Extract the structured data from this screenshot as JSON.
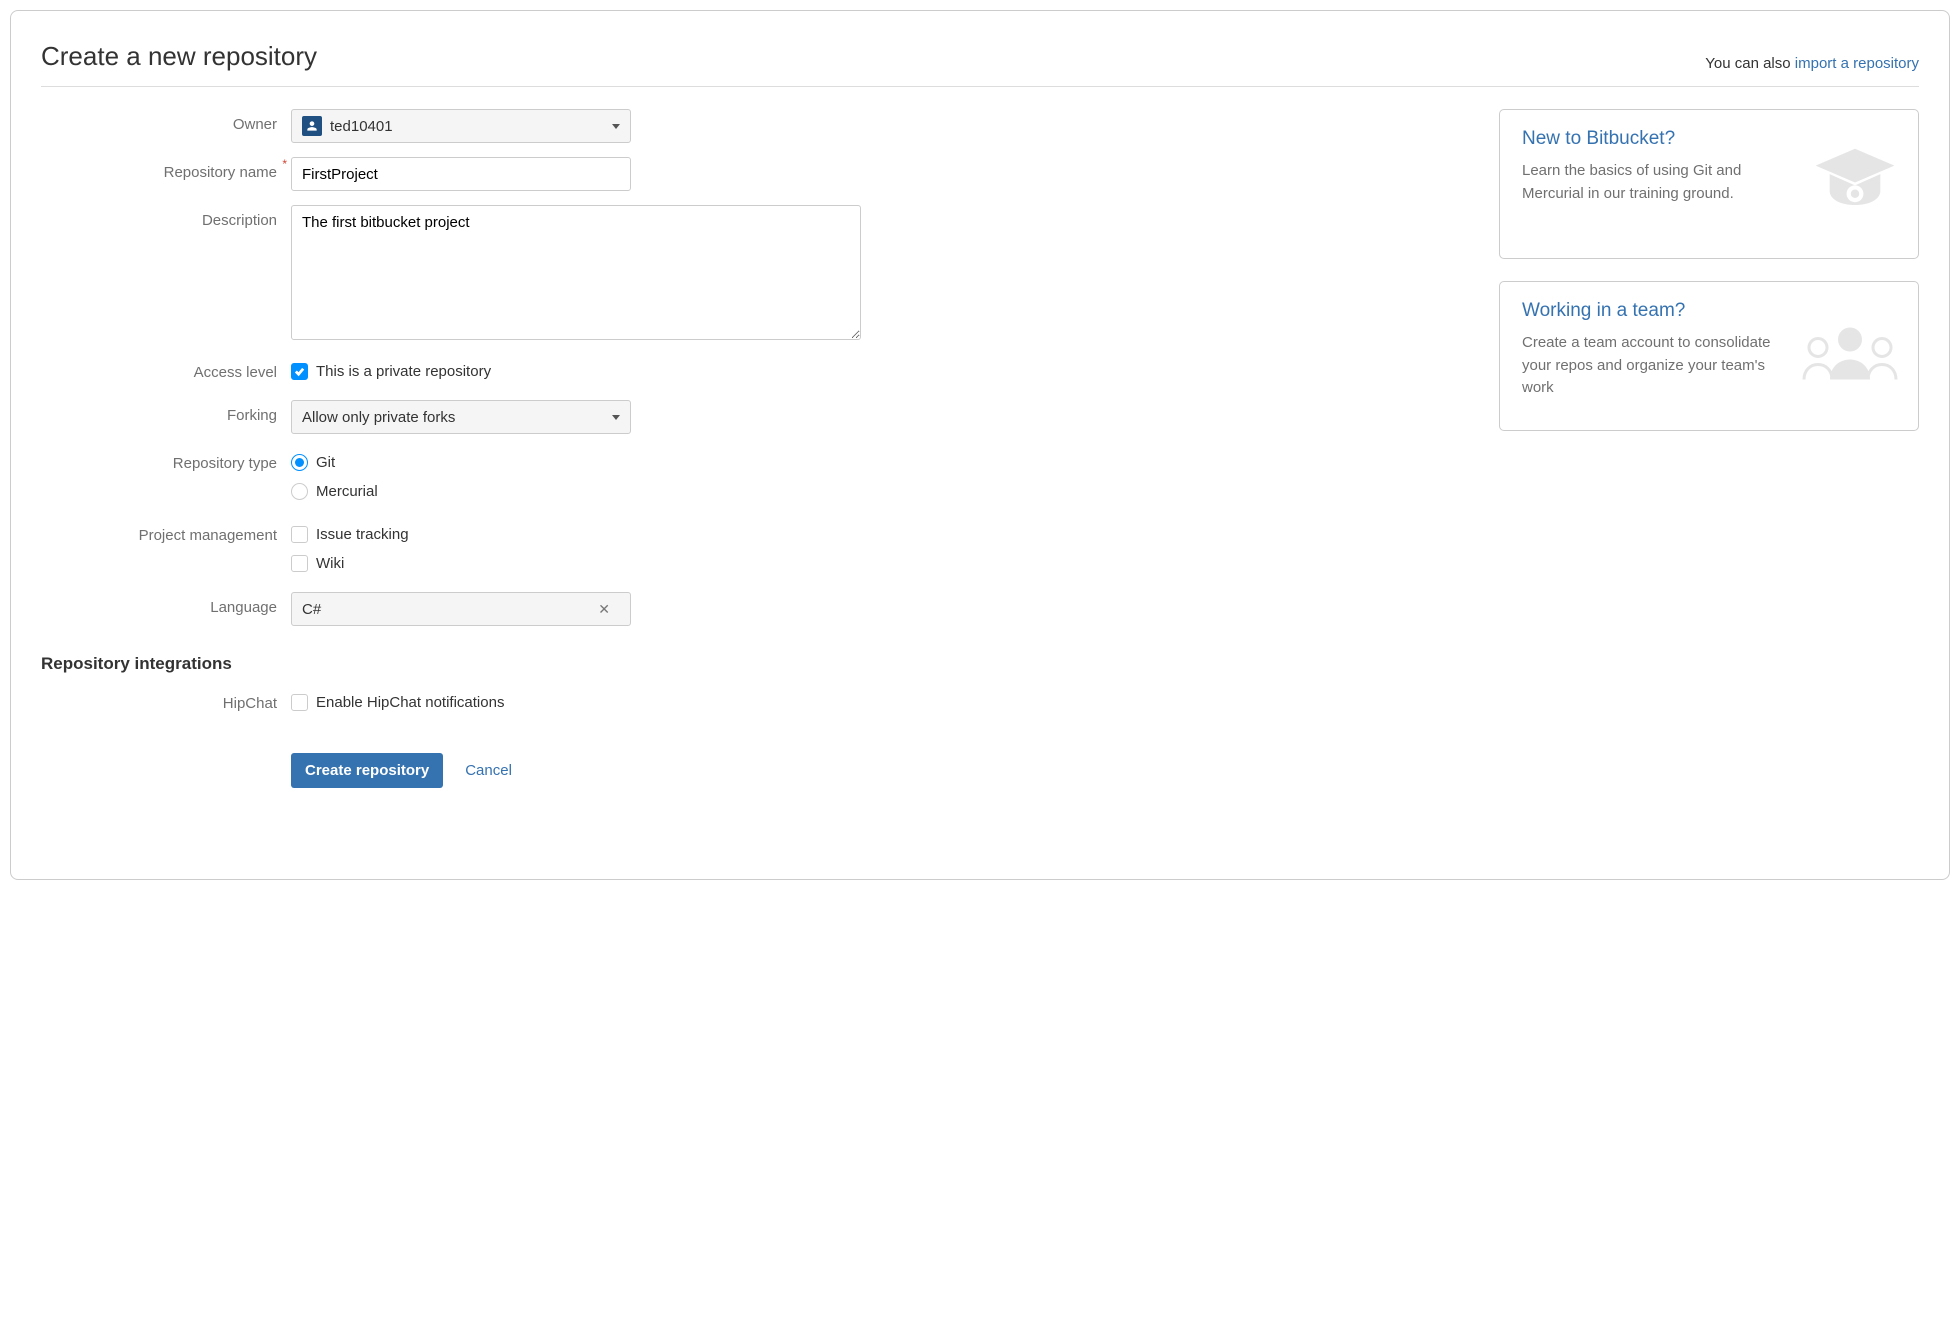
{
  "header": {
    "title": "Create a new repository",
    "import_prefix": "You can also ",
    "import_link": "import a repository"
  },
  "form": {
    "owner_label": "Owner",
    "owner_value": "ted10401",
    "name_label": "Repository name",
    "name_value": "FirstProject",
    "description_label": "Description",
    "description_value": "The first bitbucket project",
    "access_label": "Access level",
    "access_checkbox_label": "This is a private repository",
    "access_checked": true,
    "forking_label": "Forking",
    "forking_value": "Allow only private forks",
    "repotype_label": "Repository type",
    "repotype_options": {
      "git": "Git",
      "mercurial": "Mercurial"
    },
    "repotype_selected": "git",
    "projmgmt_label": "Project management",
    "projmgmt_issue_label": "Issue tracking",
    "projmgmt_issue_checked": false,
    "projmgmt_wiki_label": "Wiki",
    "projmgmt_wiki_checked": false,
    "language_label": "Language",
    "language_value": "C#"
  },
  "integrations": {
    "heading": "Repository integrations",
    "hipchat_label": "HipChat",
    "hipchat_checkbox_label": "Enable HipChat notifications",
    "hipchat_checked": false
  },
  "actions": {
    "submit": "Create repository",
    "cancel": "Cancel"
  },
  "sidebar": {
    "card1": {
      "title": "New to Bitbucket?",
      "body": "Learn the basics of using Git and Mercurial in our training ground."
    },
    "card2": {
      "title": "Working in a team?",
      "body": "Create a team account to consolidate your repos and organize your team's work"
    }
  }
}
